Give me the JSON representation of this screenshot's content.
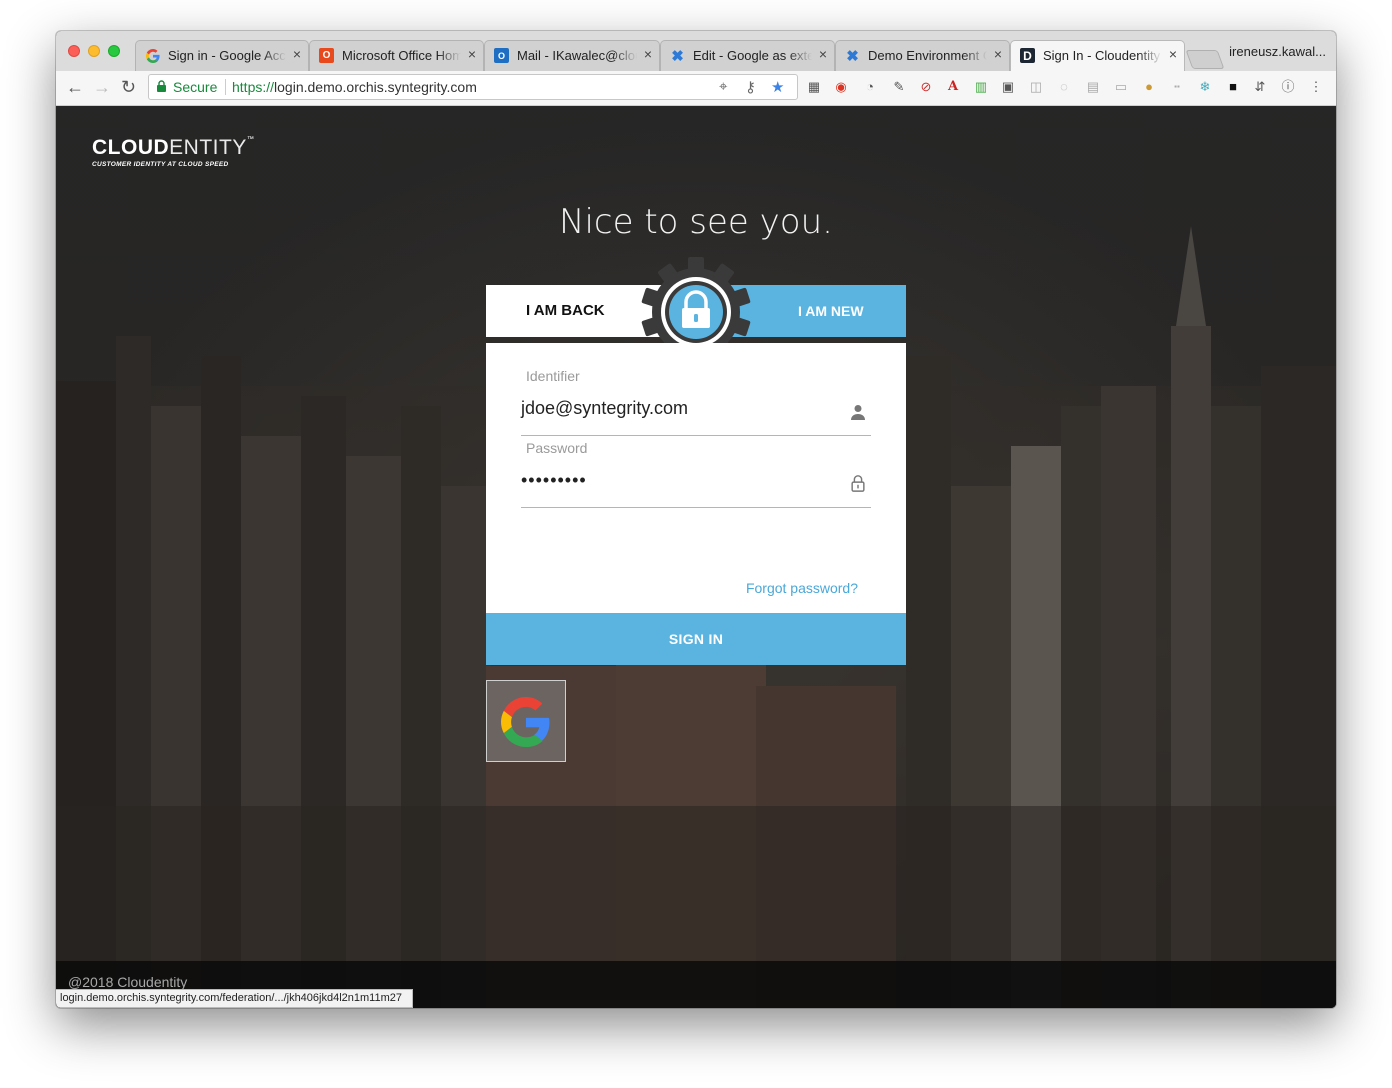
{
  "browser": {
    "tabs": [
      {
        "title": "Sign in - Google Accounts",
        "favicon": "google-g-icon",
        "active": false
      },
      {
        "title": "Microsoft Office Home",
        "favicon": "office-icon",
        "active": false
      },
      {
        "title": "Mail - IKawalec@cloudentity.com",
        "favicon": "outlook-icon",
        "active": false
      },
      {
        "title": "Edit - Google as external",
        "favicon": "confluence-icon",
        "active": false
      },
      {
        "title": "Demo Environment Guide",
        "favicon": "confluence-icon",
        "active": false
      },
      {
        "title": "Sign In - Cloudentity",
        "favicon": "cloudentity-d-icon",
        "active": true
      }
    ],
    "tab_close": "×",
    "profile_name": "ireneusz.kawal...",
    "secure_label": "Secure",
    "url_scheme": "https://",
    "url_host": "login.demo.orchis.syntegrity.com",
    "status_url": "login.demo.orchis.syntegrity.com/federation/.../jkh406jkd4l2n1m11m27",
    "nav": {
      "back": "←",
      "forward": "→",
      "reload": "↻"
    }
  },
  "page": {
    "logo_bold": "CLOUD",
    "logo_light": "ENTITY",
    "logo_tm": "™",
    "tagline": "CUSTOMER IDENTITY AT CLOUD SPEED",
    "heading": "Nice to see you.",
    "tab_back": "I AM BACK",
    "tab_new": "I AM NEW",
    "identifier_label": "Identifier",
    "identifier_value": "jdoe@syntegrity.com",
    "password_label": "Password",
    "password_value": "•••••••••",
    "forgot_password": "Forgot password?",
    "sign_in": "SIGN IN",
    "copyright": "@2018 Cloudentity"
  },
  "colors": {
    "accent": "#5bb4e0",
    "link": "#4aa8d8",
    "secure_green": "#178a3c"
  }
}
